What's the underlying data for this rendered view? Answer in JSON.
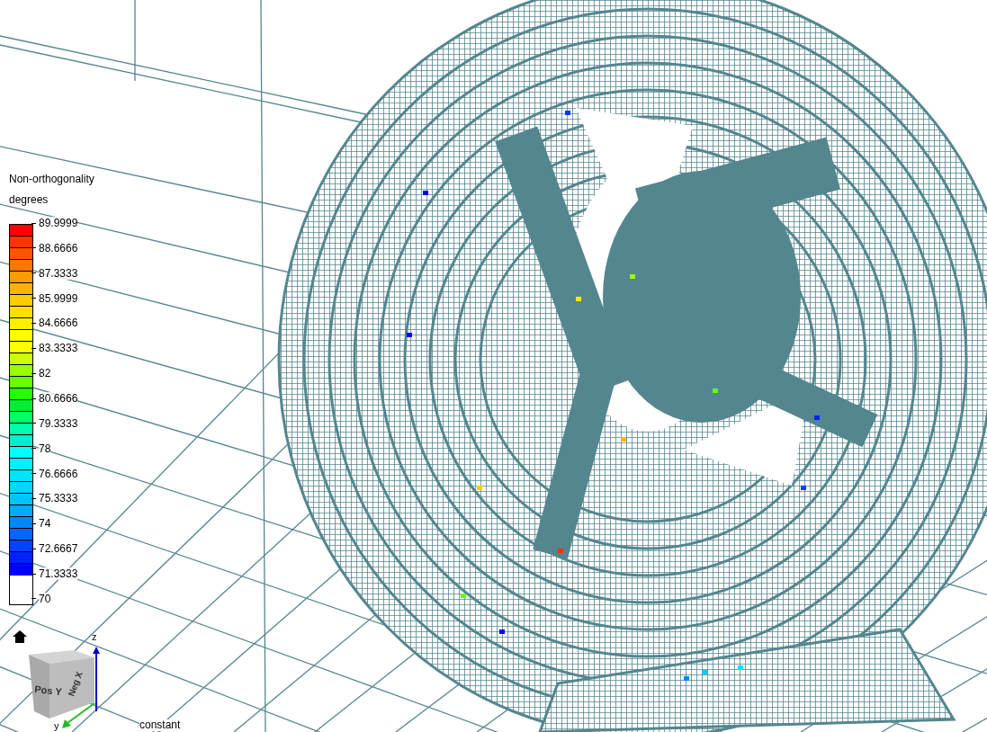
{
  "legend": {
    "title": "Non-orthogonality",
    "unit": "degrees",
    "swatches": [
      {
        "color": "#ff0000"
      },
      {
        "color": "#ff3300"
      },
      {
        "color": "#ff5500"
      },
      {
        "color": "#ff7700"
      },
      {
        "color": "#ff9900"
      },
      {
        "color": "#ffb300"
      },
      {
        "color": "#ffcc00"
      },
      {
        "color": "#ffdd00"
      },
      {
        "color": "#ffee00"
      },
      {
        "color": "#ffff00"
      },
      {
        "color": "#fffe00"
      },
      {
        "color": "#ccff00"
      },
      {
        "color": "#99ff00"
      },
      {
        "color": "#66ff00"
      },
      {
        "color": "#22ff00"
      },
      {
        "color": "#00ee33"
      },
      {
        "color": "#00ff66"
      },
      {
        "color": "#00ffaa"
      },
      {
        "color": "#00eecc"
      },
      {
        "color": "#00ffff"
      },
      {
        "color": "#00f0ff"
      },
      {
        "color": "#00e4ff"
      },
      {
        "color": "#00d8ff"
      },
      {
        "color": "#00c4ff"
      },
      {
        "color": "#00aaff"
      },
      {
        "color": "#0088ff"
      },
      {
        "color": "#0066ff"
      },
      {
        "color": "#0044ff"
      },
      {
        "color": "#0022ff"
      },
      {
        "color": "#0000ff"
      }
    ],
    "labels": [
      "89.9999",
      "88.6666",
      "87.3333",
      "85.9999",
      "84.6666",
      "83.3333",
      "82",
      "80.6666",
      "79.3333",
      "78",
      "76.6666",
      "75.3333",
      "74",
      "72.6667",
      "71.3333",
      "70"
    ]
  },
  "orientation_cube": {
    "faces": [
      "Pos Y",
      "Neg X"
    ],
    "axes": [
      "z",
      "y"
    ]
  },
  "footer_text": "constant"
}
